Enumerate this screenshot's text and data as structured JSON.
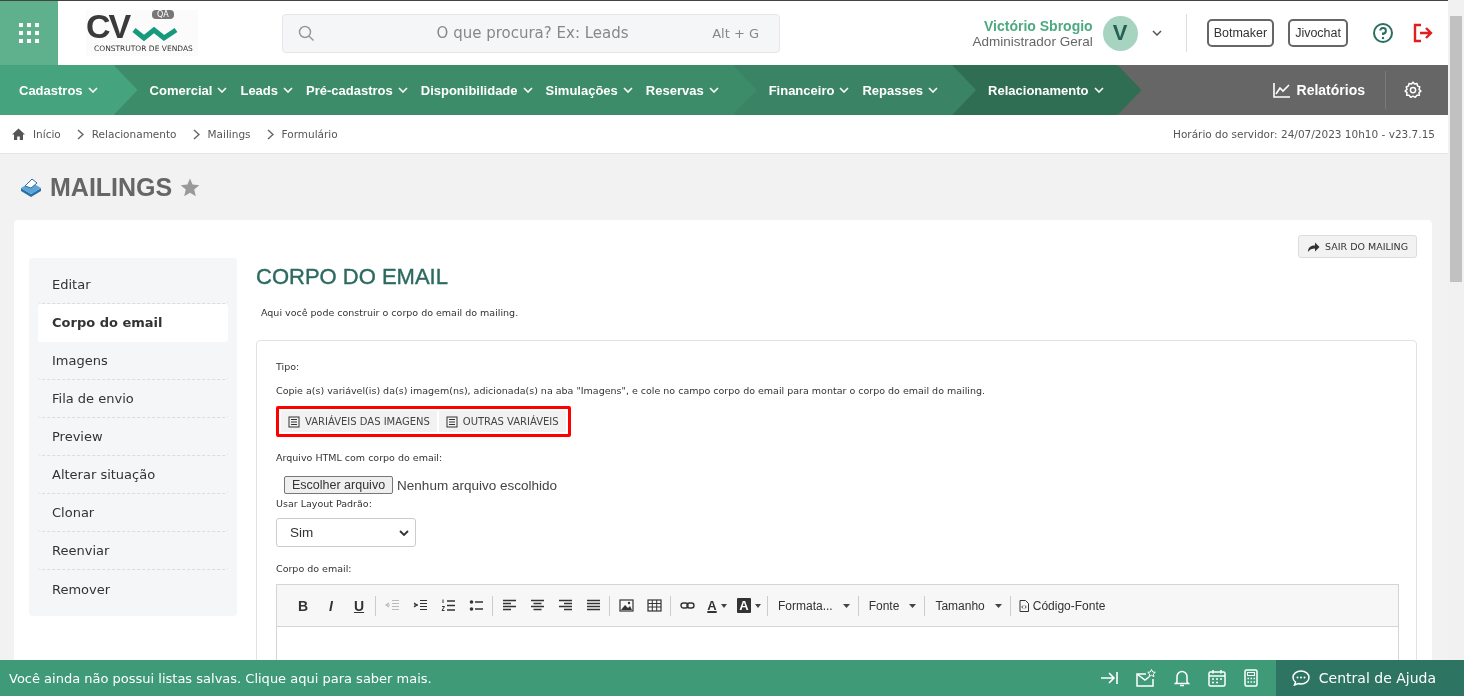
{
  "header": {
    "logo": {
      "text": "CV",
      "badge": "QA",
      "tagline": "CONSTRUTOR DE VENDAS"
    },
    "search": {
      "placeholder": "O que procura? Ex: Leads",
      "shortcut": "Alt + G"
    },
    "user": {
      "name": "Victório Sbrogio",
      "role": "Administrador Geral",
      "initial": "V"
    },
    "buttons": [
      "Botmaker",
      "Jivochat"
    ]
  },
  "nav": {
    "groups": [
      {
        "items": [
          "Cadastros"
        ]
      },
      {
        "items": [
          "Comercial",
          "Leads",
          "Pré-cadastros",
          "Disponibilidade",
          "Simulações",
          "Reservas"
        ]
      },
      {
        "items": [
          "Financeiro",
          "Repasses"
        ]
      },
      {
        "items": [
          "Relacionamento"
        ]
      }
    ],
    "reports": "Relatórios"
  },
  "breadcrumb": [
    "Início",
    "Relacionamento",
    "Mailings",
    "Formulário"
  ],
  "server_time": "Horário do servidor: 24/07/2023 10h10 - v23.7.15",
  "page_title": "MAILINGS",
  "sidebar": {
    "items": [
      {
        "label": "Editar",
        "selected": false
      },
      {
        "label": "Corpo do email",
        "selected": true
      },
      {
        "label": "Imagens",
        "selected": false
      },
      {
        "label": "Fila de envio",
        "selected": false
      },
      {
        "label": "Preview",
        "selected": false
      },
      {
        "label": "Alterar situação",
        "selected": false
      },
      {
        "label": "Clonar",
        "selected": false
      },
      {
        "label": "Reenviar",
        "selected": false
      },
      {
        "label": "Remover",
        "selected": false
      }
    ]
  },
  "exit_button": "SAIR DO MAILING",
  "section_title": "CORPO DO EMAIL",
  "description": "Aqui você pode construir o corpo do email do mailing.",
  "form": {
    "type_label": "Tipo:",
    "instructions": "Copie a(s) variável(is) da(s) imagem(ns), adicionada(s) na aba \"Imagens\", e cole no campo corpo do email para montar o corpo do email do mailing.",
    "variable_buttons": [
      "VARIÁVEIS DAS IMAGENS",
      "OUTRAS VARIÁVEIS"
    ],
    "file_label": "Arquivo HTML com corpo do email:",
    "file_button": "Escolher arquivo",
    "file_status": "Nenhum arquivo escolhido",
    "layout_label": "Usar Layout Padrão:",
    "layout_value": "Sim",
    "body_label": "Corpo do email:",
    "toolbar": [
      {
        "kind": "glyph",
        "label": "B",
        "disabled": false
      },
      {
        "kind": "glyph",
        "label": "I",
        "disabled": false
      },
      {
        "kind": "glyph",
        "label": "U",
        "disabled": false
      },
      {
        "kind": "sep"
      },
      {
        "kind": "outdent",
        "disabled": true
      },
      {
        "kind": "indent",
        "disabled": false
      },
      {
        "kind": "ordered-list",
        "disabled": false
      },
      {
        "kind": "bullet-list",
        "disabled": false
      },
      {
        "kind": "sep"
      },
      {
        "kind": "align-left",
        "disabled": false
      },
      {
        "kind": "align-center",
        "disabled": false
      },
      {
        "kind": "align-right",
        "disabled": false
      },
      {
        "kind": "justify",
        "disabled": false
      },
      {
        "kind": "sep"
      },
      {
        "kind": "image",
        "disabled": false
      },
      {
        "kind": "table",
        "disabled": false
      },
      {
        "kind": "sep"
      },
      {
        "kind": "link",
        "disabled": false
      },
      {
        "kind": "text-color",
        "label": "A",
        "disabled": false
      },
      {
        "kind": "bg-color",
        "label": "A",
        "disabled": false
      },
      {
        "kind": "sep"
      },
      {
        "kind": "dropdown",
        "label": "Formata...",
        "disabled": false
      },
      {
        "kind": "sep"
      },
      {
        "kind": "dropdown",
        "label": "Fonte",
        "disabled": false
      },
      {
        "kind": "sep"
      },
      {
        "kind": "dropdown",
        "label": "Tamanho",
        "disabled": false
      },
      {
        "kind": "sep"
      },
      {
        "kind": "source",
        "label": "Código-Fonte",
        "disabled": false
      }
    ]
  },
  "footer": {
    "message": "Você ainda não possui listas salvas. Clique aqui para saber mais.",
    "help": "Central de Ajuda"
  }
}
